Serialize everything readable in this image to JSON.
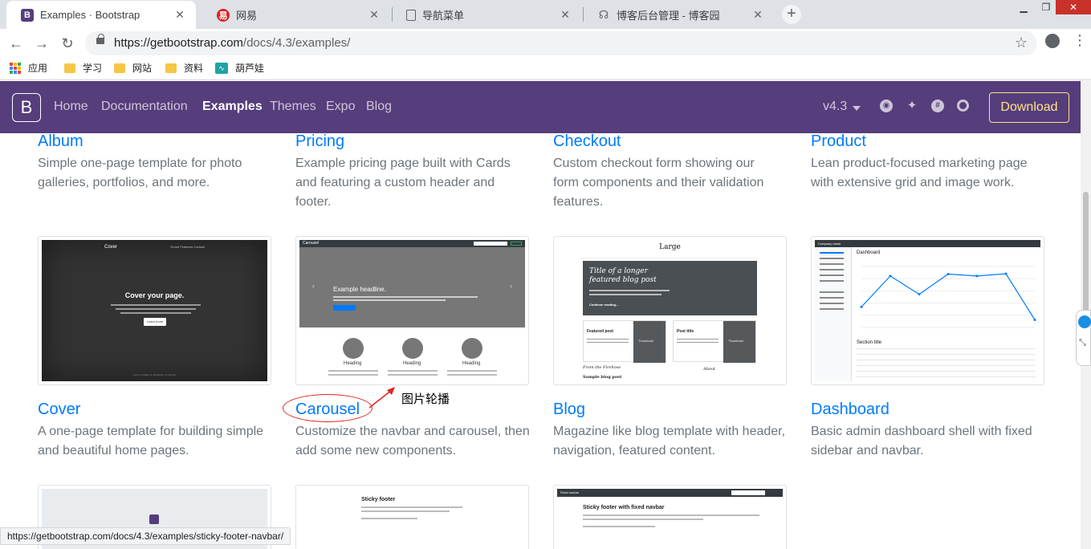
{
  "browser": {
    "tabs": [
      {
        "title": "Examples · Bootstrap",
        "favicon": "B",
        "active": true
      },
      {
        "title": "网易",
        "favicon": "易",
        "active": false
      },
      {
        "title": "导航菜单",
        "favicon": "",
        "active": false
      },
      {
        "title": "博客后台管理 - 博客园",
        "favicon": "",
        "active": false
      }
    ],
    "url_host": "https://getbootstrap.com",
    "url_path": "/docs/4.3/examples/",
    "bookmarks": [
      "应用",
      "学习",
      "网站",
      "资料",
      "葫芦娃"
    ],
    "status_url": "https://getbootstrap.com/docs/4.3/examples/sticky-footer-navbar/"
  },
  "navbar": {
    "logo": "B",
    "links": [
      "Home",
      "Documentation",
      "Examples",
      "Themes",
      "Expo",
      "Blog"
    ],
    "active_link": "Examples",
    "version": "v4.3",
    "download_label": "Download",
    "brand_color": "#563d7c",
    "download_color": "#ffe484"
  },
  "examples": {
    "row1": [
      {
        "title": "Album",
        "desc": "Simple one-page template for photo galleries, portfolios, and more."
      },
      {
        "title": "Pricing",
        "desc": "Example pricing page built with Cards and featuring a custom header and footer."
      },
      {
        "title": "Checkout",
        "desc": "Custom checkout form showing our form components and their validation features."
      },
      {
        "title": "Product",
        "desc": "Lean product-focused marketing page with extensive grid and image work."
      }
    ],
    "row2": [
      {
        "title": "Cover",
        "desc": "A one-page template for building simple and beautiful home pages."
      },
      {
        "title": "Carousel",
        "desc": "Customize the navbar and carousel, then add some new components."
      },
      {
        "title": "Blog",
        "desc": "Magazine like blog template with header, navigation, featured content."
      },
      {
        "title": "Dashboard",
        "desc": "Basic admin dashboard shell with fixed sidebar and navbar."
      }
    ]
  },
  "thumbs": {
    "cover": {
      "brand": "Cover",
      "nav": "Home  Features  Contact",
      "heading": "Cover your page.",
      "button": "Learn more",
      "footer": "Cover template for Bootstrap, by @mdo."
    },
    "carousel": {
      "brand": "Carousel",
      "headline": "Example headline.",
      "headings": [
        "Heading",
        "Heading",
        "Heading"
      ]
    },
    "blog": {
      "brand": "Large",
      "jumbo_title": "Title of a longer featured blog post",
      "jumbo_link": "Continue reading...",
      "cards": [
        "Featured post",
        "Post title"
      ],
      "card_image": "Thumbnail",
      "footer_left": "From the Firehose",
      "footer_left2": "Sample blog post",
      "footer_right": "About"
    },
    "dashboard": {
      "topbar": "Company name",
      "heading": "Dashboard",
      "section": "Section title"
    },
    "sticky_footer": {
      "title": "Sticky footer"
    },
    "sticky_footer_navbar": {
      "brand": "Fixed navbar",
      "title": "Sticky footer with fixed navbar"
    }
  },
  "annotation": {
    "text": "图片轮播",
    "color": "#e02424"
  },
  "chart_data": {
    "type": "line",
    "values": [
      15400,
      23500,
      18700,
      24000,
      23500,
      24100,
      12000
    ]
  }
}
